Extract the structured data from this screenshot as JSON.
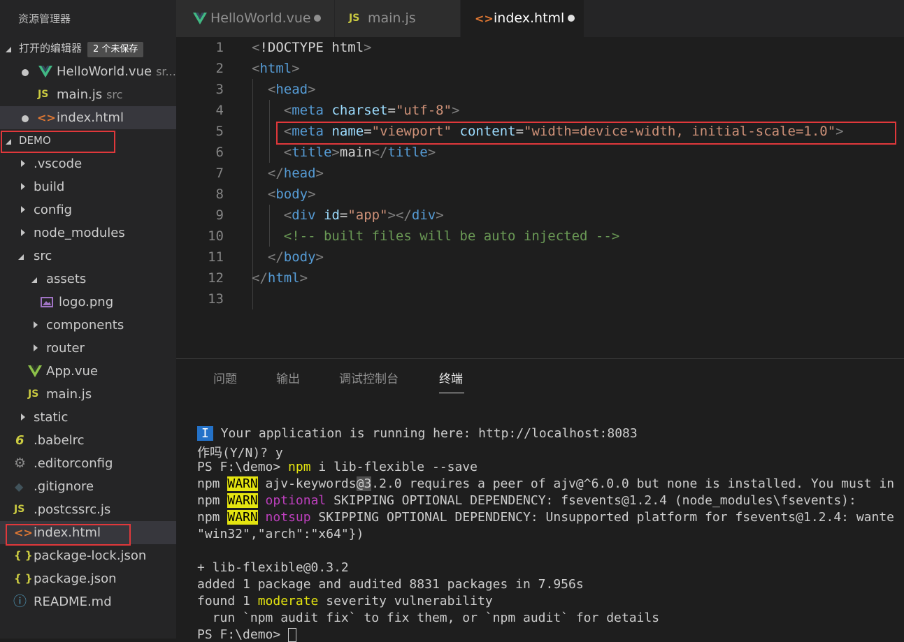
{
  "sidebar": {
    "title": "资源管理器",
    "open_editors": {
      "label": "打开的编辑器",
      "badge": "2 个未保存",
      "items": [
        {
          "name": "HelloWorld.vue",
          "desc": "sr...",
          "icon": "vue-icon",
          "unsaved": true
        },
        {
          "name": "main.js",
          "desc": "src",
          "icon": "js-icon",
          "unsaved": false
        },
        {
          "name": "index.html",
          "desc": "",
          "icon": "html-icon",
          "unsaved": true
        }
      ]
    },
    "project": {
      "label": "DEMO",
      "tree": [
        {
          "label": ".vscode",
          "icon": "folder"
        },
        {
          "label": "build",
          "icon": "folder"
        },
        {
          "label": "config",
          "icon": "folder"
        },
        {
          "label": "node_modules",
          "icon": "folder"
        },
        {
          "label": "src",
          "icon": "folder-open"
        },
        {
          "label": "assets",
          "icon": "folder-open"
        },
        {
          "label": "logo.png",
          "icon": "image-icon"
        },
        {
          "label": "components",
          "icon": "folder"
        },
        {
          "label": "router",
          "icon": "folder"
        },
        {
          "label": "App.vue",
          "icon": "vue-icon"
        },
        {
          "label": "main.js",
          "icon": "js-icon"
        },
        {
          "label": "static",
          "icon": "folder"
        },
        {
          "label": ".babelrc",
          "icon": "babel-icon"
        },
        {
          "label": ".editorconfig",
          "icon": "gear-icon"
        },
        {
          "label": ".gitignore",
          "icon": "git-icon"
        },
        {
          "label": ".postcssrc.js",
          "icon": "js-icon"
        },
        {
          "label": "index.html",
          "icon": "html-icon"
        },
        {
          "label": "package-lock.json",
          "icon": "json-icon"
        },
        {
          "label": "package.json",
          "icon": "json-icon"
        },
        {
          "label": "README.md",
          "icon": "info-icon"
        }
      ]
    }
  },
  "tabs": [
    {
      "label": "HelloWorld.vue",
      "icon": "vue-icon",
      "unsaved": true
    },
    {
      "label": "main.js",
      "icon": "js-icon",
      "unsaved": false
    },
    {
      "label": "index.html",
      "icon": "html-icon",
      "unsaved": true
    }
  ],
  "icon_glyphs": {
    "js": "JS",
    "html": "<>",
    "json": "{ }",
    "babel": "6",
    "info": "ⓘ",
    "vue": "V",
    "gear": "⚙",
    "git": "◆"
  },
  "editor": {
    "line_numbers": [
      "1",
      "2",
      "3",
      "4",
      "5",
      "6",
      "7",
      "8",
      "9",
      "10",
      "11",
      "12",
      "13"
    ],
    "lines": [
      "<!DOCTYPE html>",
      "<html>",
      "  <head>",
      "    <meta charset=\"utf-8\">",
      "    <meta name=\"viewport\" content=\"width=device-width, initial-scale=1.0\">",
      "    <title>main</title>",
      "  </head>",
      "  <body>",
      "    <div id=\"app\"></div>",
      "    <!-- built files will be auto injected -->",
      "  </body>",
      "</html>",
      ""
    ]
  },
  "panel": {
    "tabs": [
      "问题",
      "输出",
      "调试控制台",
      "终端"
    ],
    "active_tab": "终端",
    "terminal": {
      "line1_badge": "I",
      "line1_text": " Your application is running here: http://localhost:8083",
      "line2": "作吗(Y/N)? y",
      "line3_prompt": "PS F:\\demo> ",
      "line3_cmd": "npm",
      "line3_rest": " i lib-flexible --save",
      "npm": "npm ",
      "warn": "WARN",
      "line4_a": " ajv-keywords",
      "line4_sel": "@3",
      "line4_b": ".2.0 requires a peer of ajv@^6.0.0 but none is installed. You must in",
      "line5_tag": " optional",
      "line5_rest": " SKIPPING OPTIONAL DEPENDENCY: fsevents@1.2.4 (node_modules\\fsevents):",
      "line6_tag": " notsup",
      "line6_rest": " SKIPPING OPTIONAL DEPENDENCY: Unsupported platform for fsevents@1.2.4: wante",
      "line7": "\"win32\",\"arch\":\"x64\"})",
      "line9": "+ lib-flexible@0.3.2",
      "line10": "added 1 package and audited 8831 packages in 7.956s",
      "line11_a": "found 1 ",
      "line11_b": "moderate",
      "line11_c": " severity vulnerability",
      "line12": "  run `npm audit fix` to fix them, or `npm audit` for details",
      "line13": "PS F:\\demo> "
    }
  }
}
